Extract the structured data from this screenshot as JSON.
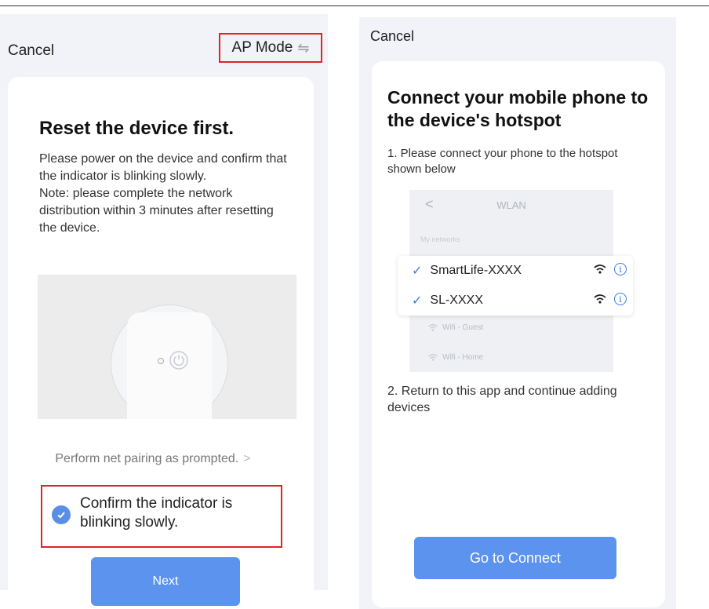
{
  "left": {
    "cancel": "Cancel",
    "ap_mode": "AP Mode",
    "ap_mode_icon": "swap-icon",
    "title": "Reset the device first.",
    "desc_line1": "Please power on the device and confirm that the indicator is blinking slowly.",
    "desc_line2": "Note: please complete the network distribution within 3 minutes after resetting the device.",
    "hint": "Perform net pairing as prompted.",
    "confirm": "Confirm the indicator is blinking slowly.",
    "next": "Next"
  },
  "right": {
    "cancel": "Cancel",
    "title": "Connect your mobile phone to the device's hotspot",
    "step1": "1. Please connect your phone to the hotspot shown below",
    "wlan": {
      "title": "WLAN",
      "my_networks": "My networks",
      "networks": [
        {
          "name": "SmartLife-XXXX"
        },
        {
          "name": "SL-XXXX"
        }
      ],
      "other": [
        "Wifi - Guest",
        "Wifi - Home"
      ]
    },
    "step2": "2. Return to this app and continue adding devices",
    "go": "Go to Connect"
  },
  "colors": {
    "accent": "#5b93ef",
    "highlight": "#e02424"
  }
}
